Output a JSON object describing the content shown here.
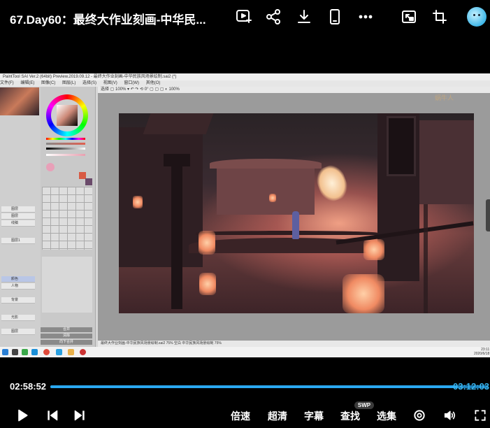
{
  "header": {
    "title": "67.Day60：最终大作业刻画-中华民..."
  },
  "sai": {
    "window_title": "PaintTool SAI Ver.2 (64bit) Preview.2019.09.12 - 最终大作业刻画-中华民族风场景绘制.sai2 (*)",
    "menu": [
      "文件(F)",
      "编辑(E)",
      "图像(C)",
      "图层(L)",
      "选择(S)",
      "视图(V)",
      "窗口(W)",
      "其他(O)"
    ],
    "toolbar_text": "选择  ▢  100%  ▾  ↶  ↷  ⟲  0°  ▢  ▢  ▢  ◐  100%",
    "watermark": "蜗牛人",
    "status_text": "最终大作业刻画-中华民族风场景绘制.sai2   75%     空白  中华民族风场景绘制   75%",
    "layers": [
      {
        "label": "图层"
      },
      {
        "label": "图层"
      },
      {
        "label": "线稿"
      },
      {
        "label": "图层1"
      },
      {
        "label": "颜色"
      },
      {
        "label": "人物"
      },
      {
        "label": "背景"
      },
      {
        "label": "光影"
      },
      {
        "label": "图层"
      }
    ],
    "panel_buttons": [
      "合并",
      "清除",
      "向下合并"
    ],
    "clock_time": "23:11",
    "clock_date": "2020/6/18"
  },
  "player": {
    "current_time": "02:58:52",
    "total_time": "03:12:03",
    "progress": 0.93,
    "controls": {
      "speed": "倍速",
      "quality": "超清",
      "subtitle": "字幕",
      "search": "查找",
      "search_badge": "SWP",
      "episodes": "选集"
    }
  },
  "colors": {
    "accent": "#2aa8f0",
    "background": "#000000"
  }
}
